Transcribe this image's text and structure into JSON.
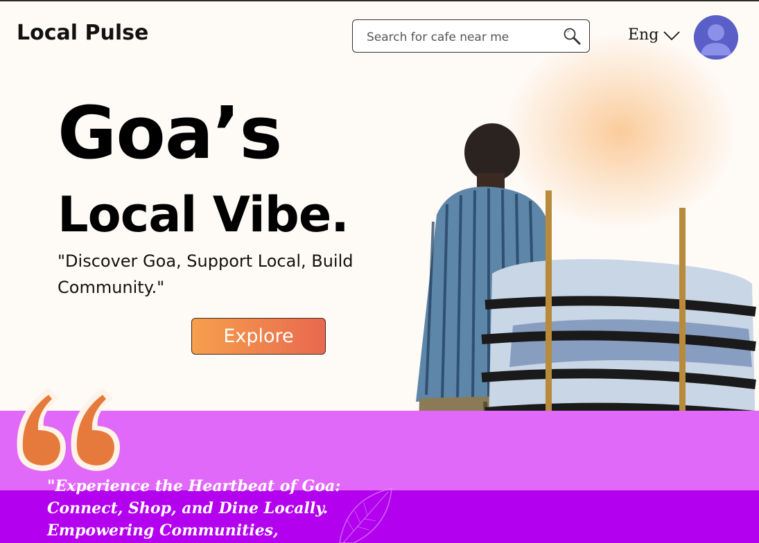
{
  "header": {
    "brand": "Local Pulse",
    "search": {
      "placeholder": "Search for cafe near me"
    },
    "language": "Eng"
  },
  "hero": {
    "title_line1": "Goa’s",
    "title_line2": "Local Vibe.",
    "tagline": "\"Discover Goa, Support Local, Build Community.\"",
    "cta": "Explore"
  },
  "quote": {
    "lines": [
      "\"Experience the Heartbeat of Goa:",
      "Connect, Shop, and Dine Locally.",
      "Empowering Communities,"
    ]
  },
  "colors": {
    "background": "#fefaf6",
    "cta_start": "#f6a04c",
    "cta_end": "#e8694f",
    "band_light": "#e169f9",
    "band_dark": "#b300ef",
    "avatar": "#5a5fc7"
  }
}
